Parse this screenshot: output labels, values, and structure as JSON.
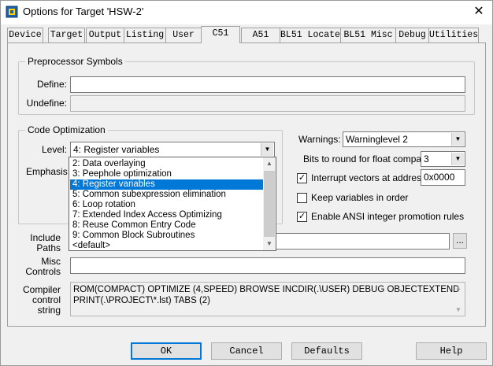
{
  "window": {
    "title": "Options for Target 'HSW-2'",
    "close_glyph": "✕"
  },
  "tabs": [
    {
      "label": "Device",
      "active": false
    },
    {
      "label": "Target",
      "active": false
    },
    {
      "label": "Output",
      "active": false
    },
    {
      "label": "Listing",
      "active": false
    },
    {
      "label": "User",
      "active": false
    },
    {
      "label": "C51",
      "active": true
    },
    {
      "label": "A51",
      "active": false
    },
    {
      "label": "BL51 Locate",
      "active": false
    },
    {
      "label": "BL51 Misc",
      "active": false
    },
    {
      "label": "Debug",
      "active": false
    },
    {
      "label": "Utilities",
      "active": false
    }
  ],
  "preprocessor": {
    "legend": "Preprocessor Symbols",
    "define_label": "Define:",
    "define_value": "",
    "undefine_label": "Undefine:",
    "undefine_value": ""
  },
  "code_optimization": {
    "legend": "Code Optimization",
    "level_label": "Level:",
    "level_value": "4: Register variables",
    "emphasis_label": "Emphasis:",
    "dropdown_options": [
      "2: Data overlaying",
      "3: Peephole optimization",
      "4: Register variables",
      "5: Common subexpression elimination",
      "6: Loop rotation",
      "7: Extended Index Access Optimizing",
      "8: Reuse Common Entry Code",
      "9: Common Block Subroutines",
      "<default>"
    ],
    "selected_index": 2
  },
  "right_options": {
    "warnings_label": "Warnings:",
    "warnings_value": "Warninglevel 2",
    "bits_label": "Bits to round for float compare:",
    "bits_value": "3",
    "interrupt_label": "Interrupt vectors at address:",
    "interrupt_checked": true,
    "interrupt_value": "0x0000",
    "keep_label": "Keep variables in order",
    "keep_checked": false,
    "ansi_label": "Enable ANSI integer promotion rules",
    "ansi_checked": true
  },
  "include": {
    "label_line1": "Include",
    "label_line2": "Paths",
    "value": "",
    "browse_label": "..."
  },
  "misc": {
    "label_line1": "Misc",
    "label_line2": "Controls",
    "value": ""
  },
  "compiler": {
    "label_line1": "Compiler",
    "label_line2": "control",
    "label_line3": "string",
    "line1": "ROM(COMPACT) OPTIMIZE (4,SPEED) BROWSE INCDIR(.\\USER) DEBUG OBJECTEXTEND",
    "line2": "PRINT(.\\PROJECT\\*.lst) TABS (2)"
  },
  "buttons": {
    "ok": "OK",
    "cancel": "Cancel",
    "defaults": "Defaults",
    "help": "Help"
  },
  "colors": {
    "selection": "#0078d7",
    "dialog_bg": "#f0f0f0"
  }
}
